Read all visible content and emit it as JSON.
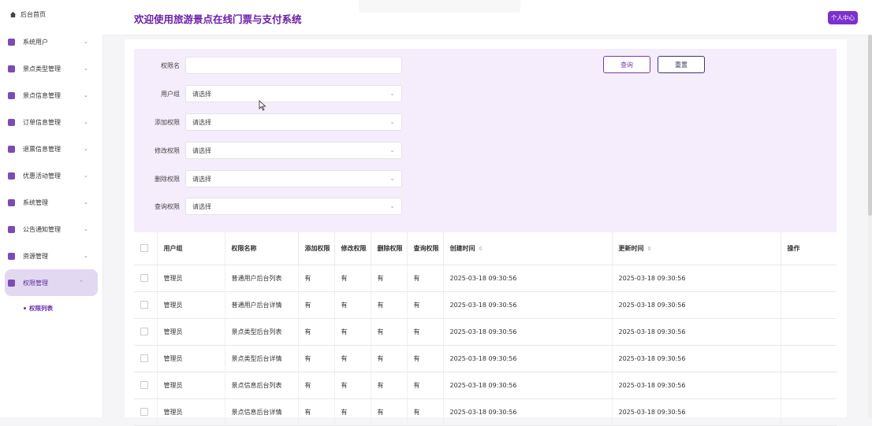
{
  "sidebar": {
    "home_label": "后台首页",
    "items": [
      {
        "label": "系统用户"
      },
      {
        "label": "景点类型管理"
      },
      {
        "label": "景点信息管理"
      },
      {
        "label": "订单信息管理"
      },
      {
        "label": "退票信息管理"
      },
      {
        "label": "优惠活动管理"
      },
      {
        "label": "系统管理"
      },
      {
        "label": "公告通知管理"
      },
      {
        "label": "资源管理"
      },
      {
        "label": "权限管理"
      }
    ],
    "sub_item": "权限列表"
  },
  "header": {
    "title": "欢迎使用旅游景点在线门票与支付系统",
    "user_center": "个人中心"
  },
  "search": {
    "fields": [
      {
        "label": "权限名",
        "value": ""
      },
      {
        "label": "用户组",
        "value": "请选择"
      },
      {
        "label": "添加权限",
        "value": "请选择"
      },
      {
        "label": "修改权限",
        "value": "请选择"
      },
      {
        "label": "删除权限",
        "value": "请选择"
      },
      {
        "label": "查询权限",
        "value": "请选择"
      }
    ],
    "query_label": "查询",
    "reset_label": "重置"
  },
  "table": {
    "headers": [
      "用户组",
      "权限名称",
      "添加权限",
      "修改权限",
      "删除权限",
      "查询权限",
      "创建时间",
      "更新时间",
      "操作"
    ],
    "rows": [
      [
        "管理员",
        "普通用户后台列表",
        "有",
        "有",
        "有",
        "有",
        "2025-03-18 09:30:56",
        "2025-03-18 09:30:56"
      ],
      [
        "管理员",
        "普通用户后台详情",
        "有",
        "有",
        "有",
        "有",
        "2025-03-18 09:30:56",
        "2025-03-18 09:30:56"
      ],
      [
        "管理员",
        "景点类型后台列表",
        "有",
        "有",
        "有",
        "有",
        "2025-03-18 09:30:56",
        "2025-03-18 09:30:56"
      ],
      [
        "管理员",
        "景点类型后台详情",
        "有",
        "有",
        "有",
        "有",
        "2025-03-18 09:30:56",
        "2025-03-18 09:30:56"
      ],
      [
        "管理员",
        "景点信息后台列表",
        "有",
        "有",
        "有",
        "有",
        "2025-03-18 09:30:56",
        "2025-03-18 09:30:56"
      ],
      [
        "管理员",
        "景点信息后台详情",
        "有",
        "有",
        "有",
        "有",
        "2025-03-18 09:30:56",
        "2025-03-18 09:30:56"
      ]
    ]
  },
  "colors": {
    "accent": "#7e2fcf",
    "search_bg": "#f5edfb"
  }
}
